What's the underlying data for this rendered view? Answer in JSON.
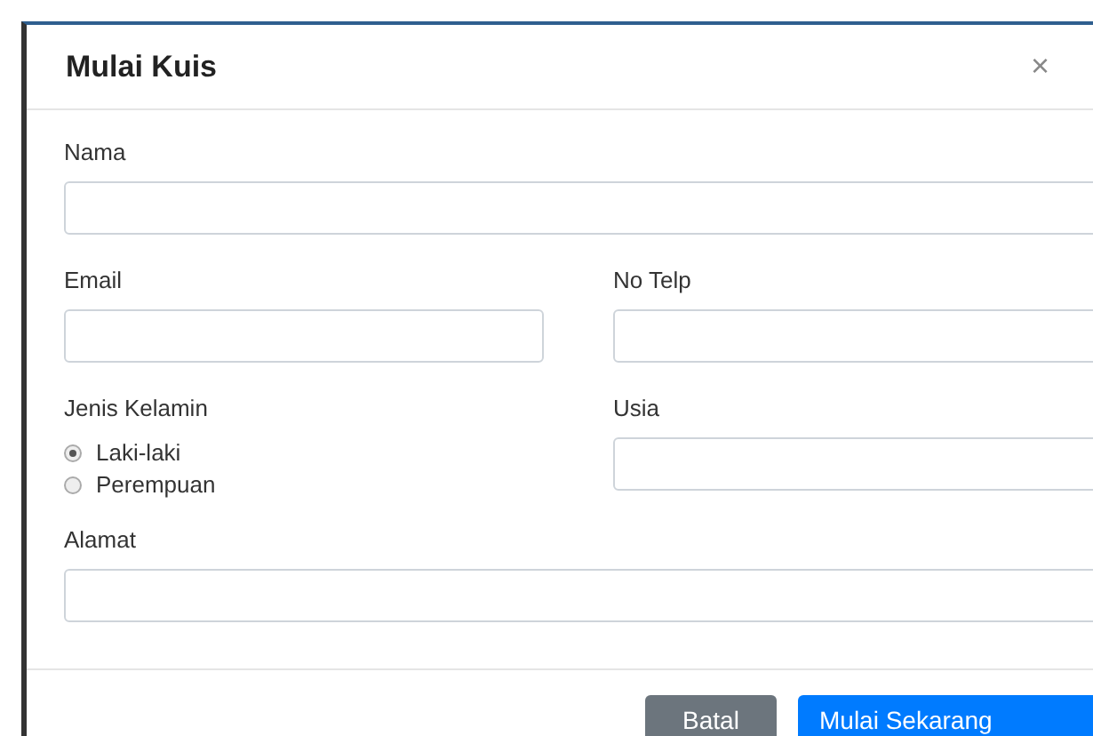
{
  "modal": {
    "title": "Mulai Kuis",
    "close": "×"
  },
  "fields": {
    "nama": {
      "label": "Nama"
    },
    "email": {
      "label": "Email"
    },
    "no_telp": {
      "label": "No Telp"
    },
    "usia": {
      "label": "Usia"
    },
    "alamat": {
      "label": "Alamat"
    }
  },
  "gender": {
    "label": "Jenis Kelamin",
    "options": [
      {
        "label": "Laki-laki",
        "selected": true
      },
      {
        "label": "Perempuan",
        "selected": false
      }
    ]
  },
  "buttons": [
    {
      "kind": "secondary",
      "label": "Batal"
    },
    {
      "kind": "primary",
      "label": "Mulai Sekarang"
    }
  ]
}
